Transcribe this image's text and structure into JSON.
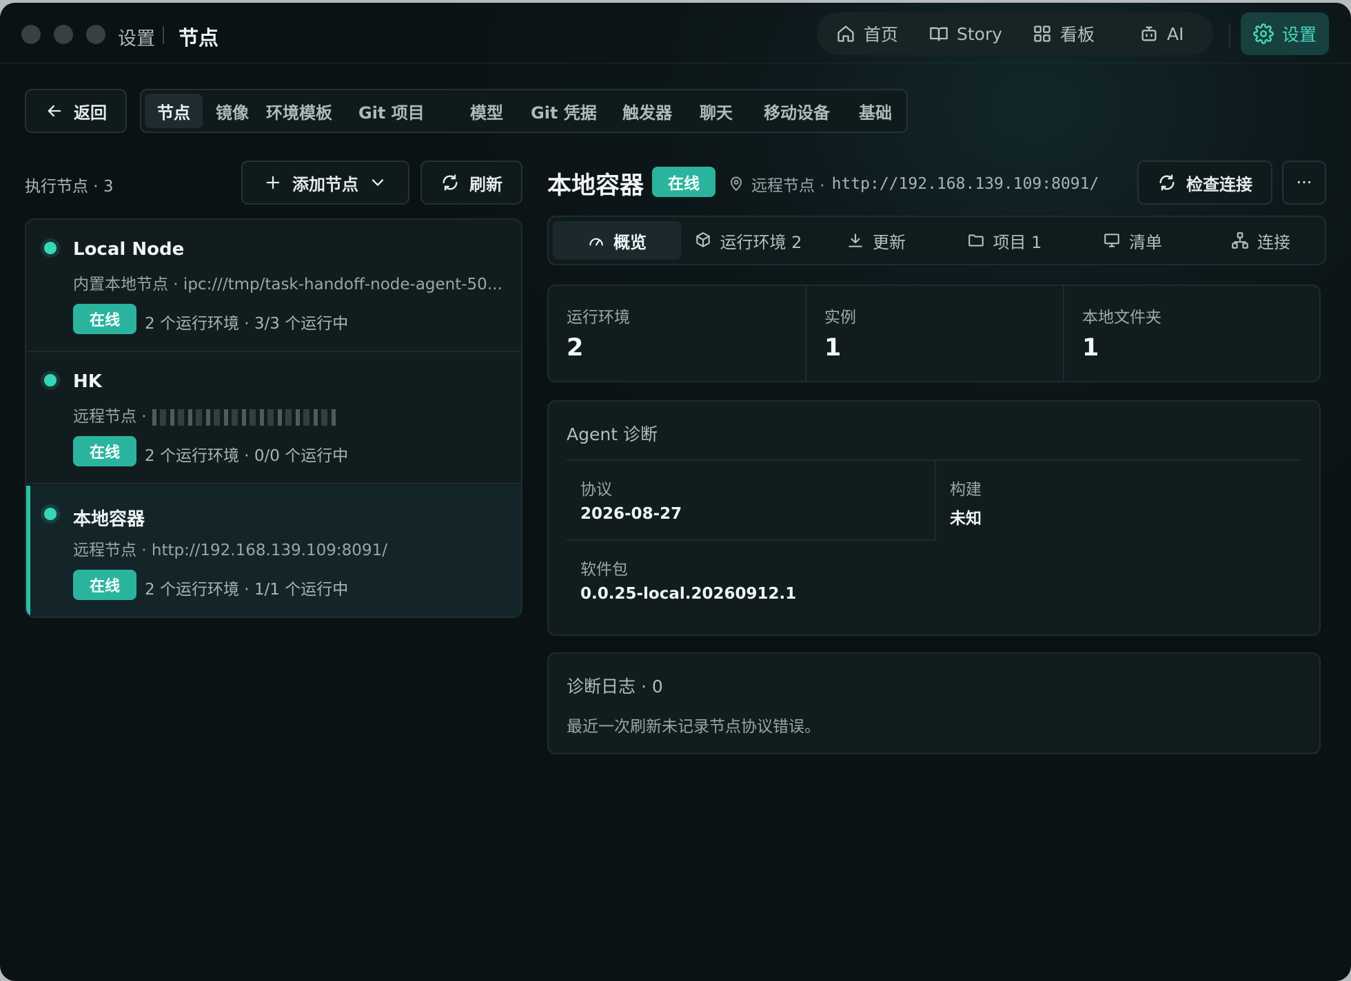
{
  "titlebar": {
    "crumb_parent": "设置",
    "crumb_current": "节点"
  },
  "topnav": {
    "items": [
      {
        "label": "首页",
        "icon": "home-icon"
      },
      {
        "label": "Story",
        "icon": "book-icon"
      },
      {
        "label": "看板",
        "icon": "grid-icon"
      },
      {
        "label": "AI",
        "icon": "robot-icon"
      }
    ],
    "settings_label": "设置",
    "accent": "#47d7bf"
  },
  "tabs": {
    "back_label": "返回",
    "items": [
      "节点",
      "镜像",
      "环境模板",
      "Git 项目",
      "模型",
      "Git 凭据",
      "触发器",
      "聊天",
      "移动设备",
      "基础"
    ],
    "active": "节点"
  },
  "nodes": {
    "count_label": "执行节点 · 3",
    "add_label": "添加节点",
    "refresh_label": "刷新",
    "list": [
      {
        "name": "Local Node",
        "sub": "内置本地节点 · ipc:///tmp/task-handoff-node-agent-50...",
        "status": "在线",
        "meta": "2 个运行环境 · 3/3 个运行中"
      },
      {
        "name": "HK",
        "sub": "远程节点 ·",
        "status": "在线",
        "meta": "2 个运行环境 · 0/0 个运行中"
      },
      {
        "name": "本地容器",
        "sub": "远程节点 · http://192.168.139.109:8091/",
        "status": "在线",
        "meta": "2 个运行环境 · 1/1 个运行中"
      }
    ],
    "status_color": "#2bb49d"
  },
  "detail": {
    "title": "本地容器",
    "status": "在线",
    "location_prefix": "远程节点 ·",
    "location_url": "http://192.168.139.109:8091/",
    "check_label": "检查连接",
    "more_label": "···",
    "subtabs": [
      {
        "label": "概览",
        "icon": "gauge-icon"
      },
      {
        "label": "运行环境 2",
        "icon": "cube-icon"
      },
      {
        "label": "更新",
        "icon": "download-icon"
      },
      {
        "label": "项目 1",
        "icon": "folder-icon"
      },
      {
        "label": "清单",
        "icon": "monitor-icon"
      },
      {
        "label": "连接",
        "icon": "network-icon"
      }
    ],
    "stats": [
      {
        "label": "运行环境",
        "value": "2"
      },
      {
        "label": "实例",
        "value": "1"
      },
      {
        "label": "本地文件夹",
        "value": "1"
      }
    ],
    "diagnostics": {
      "title": "Agent 诊断",
      "protocol_label": "协议",
      "protocol_value": "2026-08-27",
      "build_label": "构建",
      "build_value": "未知",
      "package_label": "软件包",
      "package_value": "0.0.25-local.20260912.1"
    },
    "logs": {
      "title": "诊断日志 · 0",
      "text": "最近一次刷新未记录节点协议错误。"
    }
  }
}
